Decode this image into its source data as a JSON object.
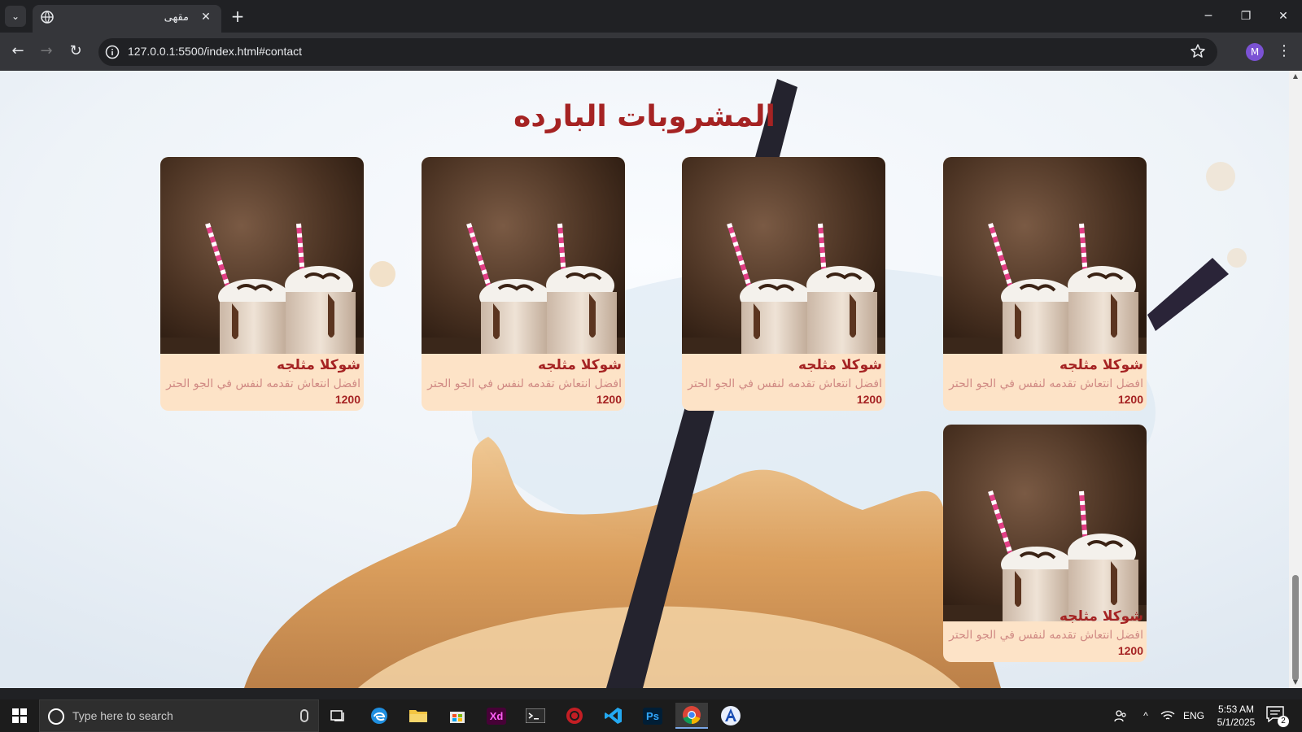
{
  "browser": {
    "tab_title": "مقهى",
    "url": "127.0.0.1:5500/index.html#contact",
    "profile_initial": "M"
  },
  "page": {
    "section_title": "المشروبات البارده",
    "cards": [
      {
        "name": "شوكلا مثلجه",
        "description": "افضل انتعاش تقدمه لنفس في الجو الحتر",
        "price": "1200"
      },
      {
        "name": "شوكلا مثلجه",
        "description": "افضل انتعاش تقدمه لنفس في الجو الحتر",
        "price": "1200"
      },
      {
        "name": "شوكلا مثلجه",
        "description": "افضل انتعاش تقدمه لنفس في الجو الحتر",
        "price": "1200"
      },
      {
        "name": "شوكلا مثلجه",
        "description": "افضل انتعاش تقدمه لنفس في الجو الحتر",
        "price": "1200"
      },
      {
        "name": "شوكلا مثلجه",
        "description": "افضل انتعاش تقدمه لنفس في الجو الحتر",
        "price": "1200"
      }
    ]
  },
  "taskbar": {
    "search_placeholder": "Type here to search",
    "apps": [
      "edge",
      "file-explorer",
      "microsoft-store",
      "adobe-xd",
      "terminal",
      "davinci",
      "vscode",
      "photoshop",
      "chrome",
      "angular"
    ],
    "xd_label": "Xd",
    "ps_label": "Ps",
    "language": "ENG",
    "time": "5:53 AM",
    "date": "5/1/2025",
    "notification_count": "2"
  },
  "colors": {
    "title": "#a52323",
    "card_bg": "#fde3c7",
    "desc": "#d08a84"
  }
}
